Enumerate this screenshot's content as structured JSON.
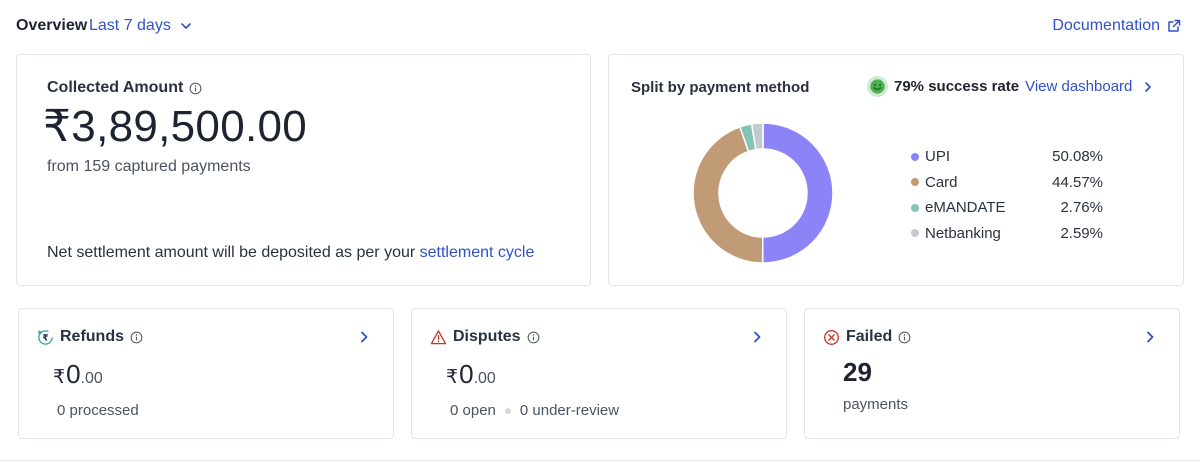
{
  "header": {
    "overview_label": "Overview",
    "range_label": "Last 7 days",
    "documentation_label": "Documentation"
  },
  "collected": {
    "label": "Collected Amount",
    "amount": "₹3,89,500.00",
    "subtext": "from 159 captured payments",
    "note_text": "Net settlement amount will be deposited as per your ",
    "note_link": "settlement cycle"
  },
  "split": {
    "title": "Split by payment method",
    "success_rate": "79% success rate",
    "view_dashboard": "View dashboard",
    "methods": [
      {
        "name": "UPI",
        "percent": "50.08%",
        "value": 50.08,
        "color": "#8c83f7"
      },
      {
        "name": "Card",
        "percent": "44.57%",
        "value": 44.57,
        "color": "#c19a76"
      },
      {
        "name": "eMANDATE",
        "percent": "2.76%",
        "value": 2.76,
        "color": "#84c4b4"
      },
      {
        "name": "Netbanking",
        "percent": "2.59%",
        "value": 2.59,
        "color": "#c3cace"
      }
    ]
  },
  "refunds": {
    "label": "Refunds",
    "currency": "₹",
    "amount_int": "0",
    "amount_dec": ".00",
    "subtext": "0 processed"
  },
  "disputes": {
    "label": "Disputes",
    "currency": "₹",
    "amount_int": "0",
    "amount_dec": ".00",
    "open": "0 open",
    "under_review": "0 under-review"
  },
  "failed": {
    "label": "Failed",
    "count": "29",
    "subtext": "payments"
  },
  "colors": {
    "accent": "#3151c6",
    "warning": "#c9372c",
    "refund_icon": "#2aa3b8",
    "success_face": "#4caf50"
  }
}
